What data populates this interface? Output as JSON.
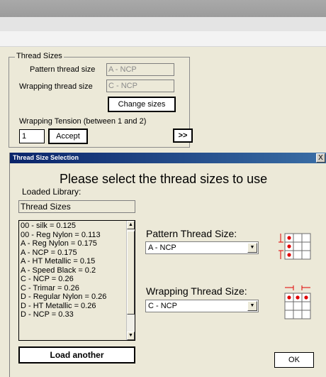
{
  "thread_sizes_group": {
    "legend": "Thread Sizes",
    "pattern_label": "Pattern thread size",
    "pattern_value": "A - NCP",
    "wrapping_label": "Wrapping thread size",
    "wrapping_value": "C - NCP",
    "change_sizes_label": "Change sizes"
  },
  "tension": {
    "label": "Wrapping Tension (between 1 and 2)",
    "value": "1",
    "accept_label": "Accept",
    "next_label": ">>"
  },
  "dialog": {
    "title": "Thread Size Selection",
    "close_label": "X",
    "heading": "Please select the thread sizes to use",
    "loaded_library_label": "Loaded Library:",
    "library_value": "Thread Sizes",
    "thread_list": [
      "00 - silk = 0.125",
      "00 - Reg Nylon = 0.113",
      "A - Reg Nylon = 0.175",
      "A - NCP = 0.175",
      "A - HT Metallic = 0.15",
      "A - Speed Black = 0.2",
      "C - NCP = 0.26",
      "C - Trimar = 0.26",
      "D - Regular Nylon = 0.26",
      "D - HT Metallic = 0.26",
      "D - NCP = 0.33"
    ],
    "pattern_thread_label": "Pattern Thread Size:",
    "pattern_thread_selected": "A - NCP",
    "wrapping_thread_label": "Wrapping Thread Size:",
    "wrapping_thread_selected": "C - NCP",
    "load_another_label": "Load another",
    "ok_label": "OK",
    "accent_color": "#e00000"
  }
}
